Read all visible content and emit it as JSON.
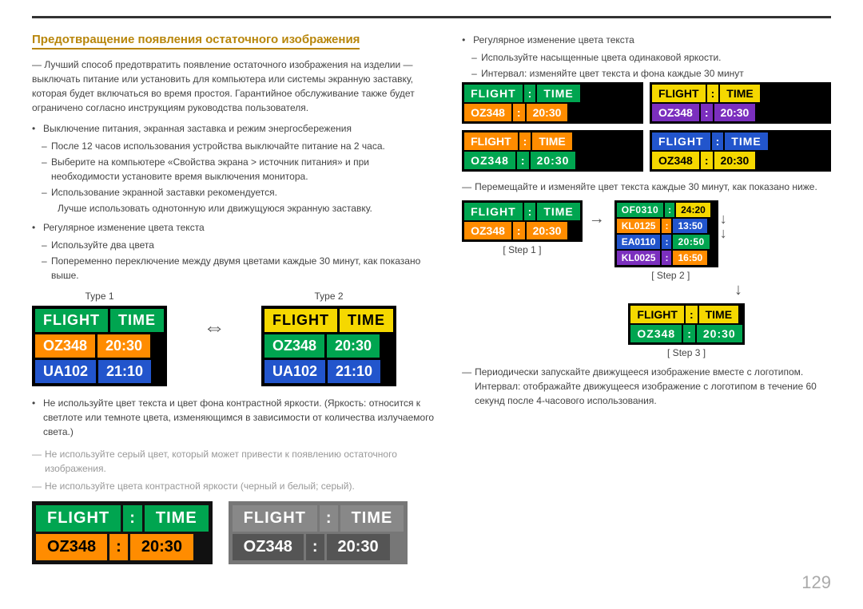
{
  "page": {
    "number": "129"
  },
  "section": {
    "title": "Предотвращение появления остаточного изображения",
    "intro": "— Лучший способ предотвратить появление остаточного изображения на изделии — выключать питание или установить для компьютера или системы экранную заставку, которая будет включаться во время простоя. Гарантийное обслуживание также будет ограничено согласно инструкциям руководства пользователя.",
    "bullet1": "Выключение питания, экранная заставка и режим энергосбережения",
    "sub1": "После 12 часов использования устройства выключайте питание на 2 часа.",
    "sub2": "Выберите на компьютере «Свойства экрана > источник питания» и при необходимости установите время выключения монитора.",
    "sub3": "Использование экранной заставки рекомендуется.",
    "sub3b": "Лучше использовать однотонную или движущуюся экранную заставку.",
    "bullet2": "Регулярное изменение цвета текста",
    "sub4": "Используйте два цвета",
    "sub5": "Попеременно переключение между двумя цветами каждые 30 минут, как показано выше.",
    "type1_label": "Type 1",
    "type2_label": "Type 2",
    "bullet3": "Не используйте цвет текста и цвет фона контрастной яркости. (Яркость: относится к светлоте или темноте цвета, изменяющимся в зависимости от количества излучаемого света.)",
    "gray1": "Не используйте серый цвет, который может привести к появлению остаточного изображения.",
    "gray2": "Не используйте цвета контрастной яркости (черный и белый; серый).",
    "right_bullet1": "Регулярное изменение цвета текста",
    "right_sub1": "Используйте насыщенные цвета одинаковой яркости.",
    "right_sub2": "Интервал: изменяйте цвет текста и фона каждые 30 минут",
    "right_dash1": "Перемещайте и изменяйте цвет текста каждые 30 минут, как показано ниже.",
    "step1_label": "[ Step 1 ]",
    "step2_label": "[ Step 2 ]",
    "step3_label": "[ Step 3 ]",
    "right_dash2": "Периодически запускайте движущееся изображение вместе с логотипом. Интервал: отображайте движущееся изображение с логотипом в течение 60 секунд после 4-часового использования.",
    "boards": {
      "type1": {
        "header": [
          "FLIGHT",
          "TIME"
        ],
        "row1": [
          "OZ348",
          "20:30"
        ],
        "row2": [
          "UA102",
          "21:10"
        ]
      },
      "type2": {
        "header": [
          "FLIGHT",
          "TIME"
        ],
        "row1": [
          "OZ348",
          "20:30"
        ],
        "row2": [
          "UA102",
          "21:10"
        ]
      },
      "top_right_1": {
        "header": [
          "FLIGHT",
          "TIME"
        ],
        "row1": [
          "OZ348",
          "20:30"
        ]
      },
      "top_right_2": {
        "header": [
          "FLIGHT",
          "TIME"
        ],
        "row1": [
          "OZ348",
          "20:30"
        ]
      },
      "top_right_3": {
        "header": [
          "FLIGHT",
          "TIME"
        ],
        "row1": [
          "OZ348",
          "20:30"
        ]
      },
      "top_right_4": {
        "header": [
          "FLIGHT",
          "TIME"
        ],
        "row1": [
          "OZ348",
          "20:30"
        ]
      },
      "step1": {
        "header": [
          "FLIGHT",
          "TIME"
        ],
        "row1": [
          "OZ348",
          "20:30"
        ]
      },
      "step2": {
        "rows": [
          [
            "OF0310",
            "24:20"
          ],
          [
            "KL0125",
            "13:50"
          ],
          [
            "EA0110",
            "20:50"
          ],
          [
            "KL0025",
            "16:50"
          ]
        ]
      },
      "step3": {
        "header": [
          "FLIGHT",
          "TIME"
        ],
        "row1": [
          "OZ348",
          "20:30"
        ]
      },
      "bottom_left": {
        "header": [
          "FLIGHT",
          "TIME"
        ],
        "row1": [
          "OZ348",
          "20:30"
        ]
      },
      "bottom_right": {
        "header": [
          "FLIGHT",
          "TIME"
        ],
        "row1": [
          "OZ348",
          "20:30"
        ]
      }
    }
  }
}
